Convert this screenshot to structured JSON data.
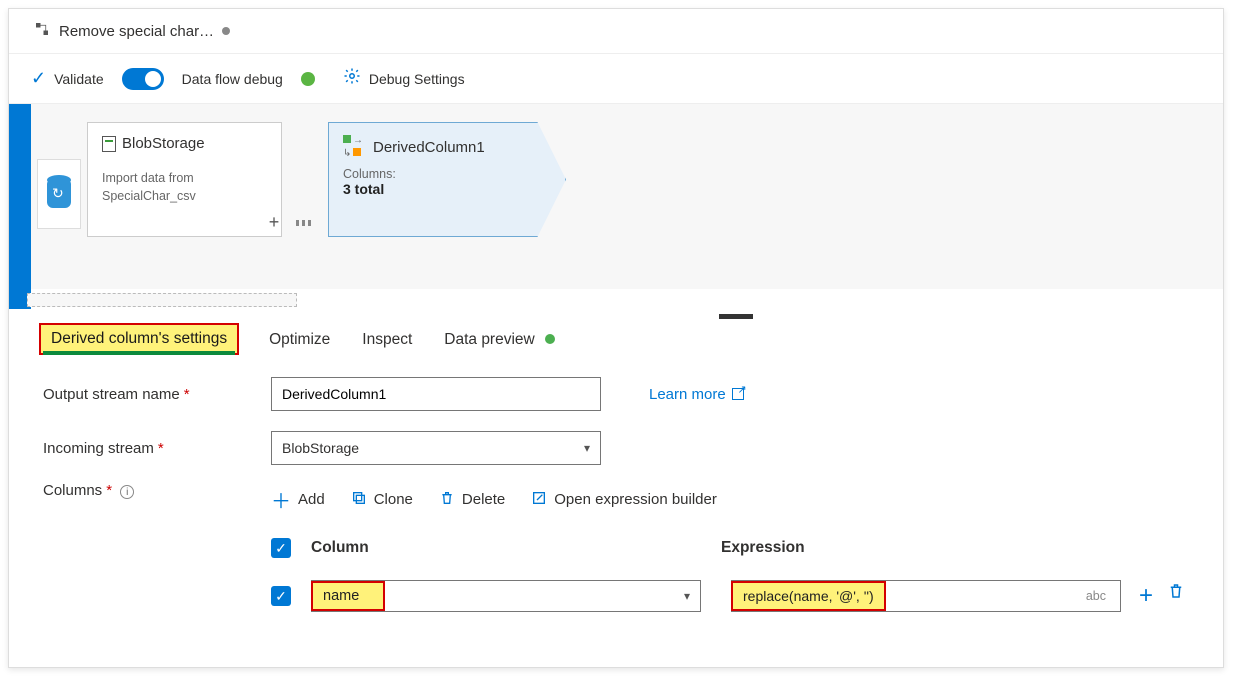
{
  "tab": {
    "title": "Remove special char…"
  },
  "toolbar": {
    "validate": "Validate",
    "debug_label": "Data flow debug",
    "debug_settings": "Debug Settings"
  },
  "nodes": {
    "source": {
      "title": "BlobStorage",
      "sub1": "Import data from",
      "sub2": "SpecialChar_csv"
    },
    "derived": {
      "title": "DerivedColumn1",
      "columns_label": "Columns:",
      "columns_count": "3 total"
    }
  },
  "settings_tabs": {
    "derived": "Derived column's settings",
    "optimize": "Optimize",
    "inspect": "Inspect",
    "preview": "Data preview"
  },
  "form": {
    "output_label": "Output stream name",
    "output_value": "DerivedColumn1",
    "incoming_label": "Incoming stream",
    "incoming_value": "BlobStorage",
    "learn_more": "Learn more",
    "columns_label": "Columns"
  },
  "actions": {
    "add": "Add",
    "clone": "Clone",
    "delete": "Delete",
    "open_builder": "Open expression builder"
  },
  "table": {
    "header_column": "Column",
    "header_expression": "Expression",
    "rows": [
      {
        "column": "name",
        "expression": "replace(name, '@', '')",
        "type_hint": "abc"
      }
    ]
  }
}
